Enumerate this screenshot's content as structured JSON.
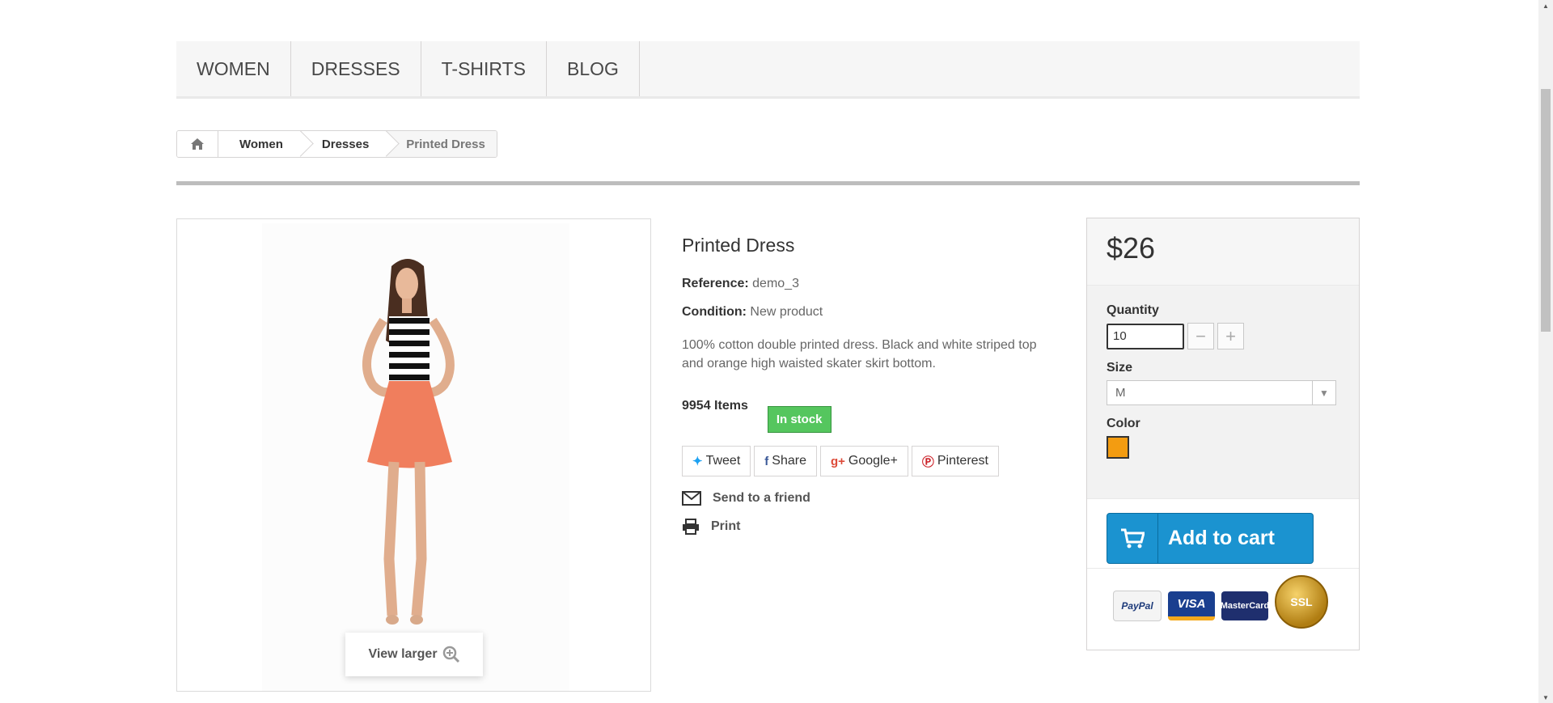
{
  "nav": {
    "items": [
      {
        "label": "WOMEN"
      },
      {
        "label": "DRESSES"
      },
      {
        "label": "T-SHIRTS"
      },
      {
        "label": "BLOG"
      }
    ]
  },
  "breadcrumb": {
    "home_icon": "home-icon",
    "items": [
      "Women",
      "Dresses"
    ],
    "current": "Printed Dress"
  },
  "product": {
    "title": "Printed Dress",
    "reference_label": "Reference:",
    "reference_value": "demo_3",
    "condition_label": "Condition:",
    "condition_value": "New product",
    "description": "100% cotton double printed dress. Black and white striped top and orange high waisted skater skirt bottom.",
    "quantity_text": "9954 Items",
    "stock_status": "In stock",
    "view_larger": "View larger"
  },
  "social": {
    "tweet": "Tweet",
    "share": "Share",
    "google": "Google+",
    "pinterest": "Pinterest"
  },
  "extra": {
    "send_friend": "Send to a friend",
    "print": "Print"
  },
  "buybox": {
    "price": "$26",
    "quantity_label": "Quantity",
    "quantity_value": "10",
    "size_label": "Size",
    "size_value": "M",
    "color_label": "Color",
    "color_value": "#f39c11",
    "add_to_cart": "Add to cart"
  },
  "payments": {
    "paypal": "PayPal",
    "visa": "VISA",
    "mastercard": "MasterCard",
    "ssl": "SSL"
  },
  "colors": {
    "accent": "#1b93d0",
    "stock_green": "#55c65e",
    "swatch_orange": "#f39c11"
  }
}
